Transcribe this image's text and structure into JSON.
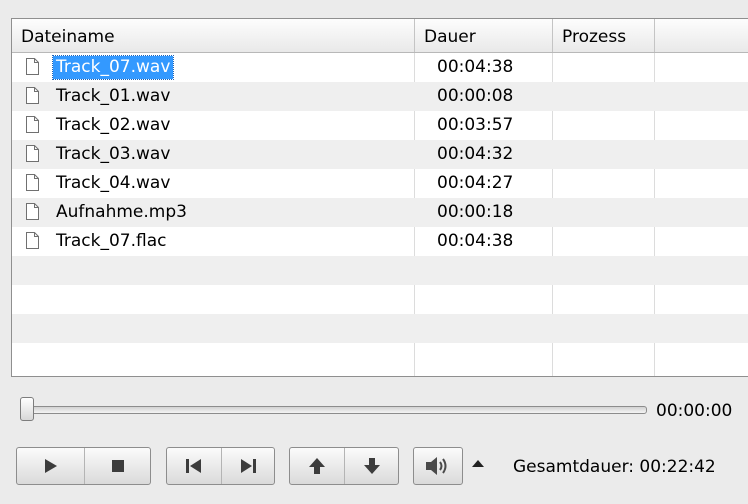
{
  "columns": {
    "filename": "Dateiname",
    "duration": "Dauer",
    "process": "Prozess"
  },
  "files": [
    {
      "name": "Track_07.wav",
      "duration": "00:04:38",
      "process": "",
      "selected": true
    },
    {
      "name": "Track_01.wav",
      "duration": "00:00:08",
      "process": ""
    },
    {
      "name": "Track_02.wav",
      "duration": "00:03:57",
      "process": ""
    },
    {
      "name": "Track_03.wav",
      "duration": "00:04:32",
      "process": ""
    },
    {
      "name": "Track_04.wav",
      "duration": "00:04:27",
      "process": ""
    },
    {
      "name": "Aufnahme.mp3",
      "duration": "00:00:18",
      "process": ""
    },
    {
      "name": "Track_07.flac",
      "duration": "00:04:38",
      "process": ""
    }
  ],
  "player": {
    "position": "00:00:00",
    "seek_fraction": 0.0,
    "total_label": "Gesamtdauer: 00:22:42"
  },
  "icons": {
    "file": "file-icon",
    "play": "play-icon",
    "stop": "stop-icon",
    "previous": "skip-previous-icon",
    "next": "skip-next-icon",
    "move_up": "arrow-up-icon",
    "move_down": "arrow-down-icon",
    "volume": "speaker-icon",
    "volume_menu": "triangle-up-icon"
  },
  "colors": {
    "selection": "#3399ff",
    "window_bg": "#ebebeb"
  }
}
